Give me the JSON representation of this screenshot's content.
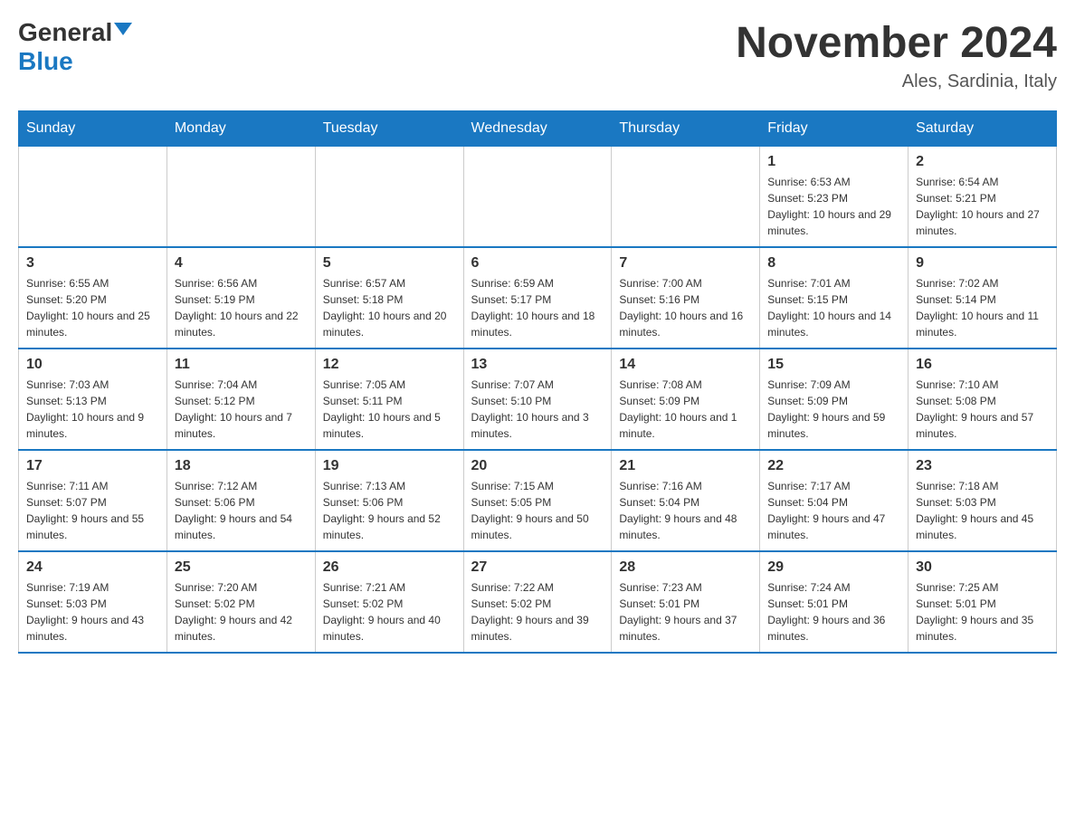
{
  "header": {
    "logo_general": "General",
    "logo_blue": "Blue",
    "month_title": "November 2024",
    "location": "Ales, Sardinia, Italy"
  },
  "days_of_week": [
    "Sunday",
    "Monday",
    "Tuesday",
    "Wednesday",
    "Thursday",
    "Friday",
    "Saturday"
  ],
  "weeks": [
    {
      "days": [
        {
          "number": "",
          "info": ""
        },
        {
          "number": "",
          "info": ""
        },
        {
          "number": "",
          "info": ""
        },
        {
          "number": "",
          "info": ""
        },
        {
          "number": "",
          "info": ""
        },
        {
          "number": "1",
          "info": "Sunrise: 6:53 AM\nSunset: 5:23 PM\nDaylight: 10 hours and 29 minutes."
        },
        {
          "number": "2",
          "info": "Sunrise: 6:54 AM\nSunset: 5:21 PM\nDaylight: 10 hours and 27 minutes."
        }
      ]
    },
    {
      "days": [
        {
          "number": "3",
          "info": "Sunrise: 6:55 AM\nSunset: 5:20 PM\nDaylight: 10 hours and 25 minutes."
        },
        {
          "number": "4",
          "info": "Sunrise: 6:56 AM\nSunset: 5:19 PM\nDaylight: 10 hours and 22 minutes."
        },
        {
          "number": "5",
          "info": "Sunrise: 6:57 AM\nSunset: 5:18 PM\nDaylight: 10 hours and 20 minutes."
        },
        {
          "number": "6",
          "info": "Sunrise: 6:59 AM\nSunset: 5:17 PM\nDaylight: 10 hours and 18 minutes."
        },
        {
          "number": "7",
          "info": "Sunrise: 7:00 AM\nSunset: 5:16 PM\nDaylight: 10 hours and 16 minutes."
        },
        {
          "number": "8",
          "info": "Sunrise: 7:01 AM\nSunset: 5:15 PM\nDaylight: 10 hours and 14 minutes."
        },
        {
          "number": "9",
          "info": "Sunrise: 7:02 AM\nSunset: 5:14 PM\nDaylight: 10 hours and 11 minutes."
        }
      ]
    },
    {
      "days": [
        {
          "number": "10",
          "info": "Sunrise: 7:03 AM\nSunset: 5:13 PM\nDaylight: 10 hours and 9 minutes."
        },
        {
          "number": "11",
          "info": "Sunrise: 7:04 AM\nSunset: 5:12 PM\nDaylight: 10 hours and 7 minutes."
        },
        {
          "number": "12",
          "info": "Sunrise: 7:05 AM\nSunset: 5:11 PM\nDaylight: 10 hours and 5 minutes."
        },
        {
          "number": "13",
          "info": "Sunrise: 7:07 AM\nSunset: 5:10 PM\nDaylight: 10 hours and 3 minutes."
        },
        {
          "number": "14",
          "info": "Sunrise: 7:08 AM\nSunset: 5:09 PM\nDaylight: 10 hours and 1 minute."
        },
        {
          "number": "15",
          "info": "Sunrise: 7:09 AM\nSunset: 5:09 PM\nDaylight: 9 hours and 59 minutes."
        },
        {
          "number": "16",
          "info": "Sunrise: 7:10 AM\nSunset: 5:08 PM\nDaylight: 9 hours and 57 minutes."
        }
      ]
    },
    {
      "days": [
        {
          "number": "17",
          "info": "Sunrise: 7:11 AM\nSunset: 5:07 PM\nDaylight: 9 hours and 55 minutes."
        },
        {
          "number": "18",
          "info": "Sunrise: 7:12 AM\nSunset: 5:06 PM\nDaylight: 9 hours and 54 minutes."
        },
        {
          "number": "19",
          "info": "Sunrise: 7:13 AM\nSunset: 5:06 PM\nDaylight: 9 hours and 52 minutes."
        },
        {
          "number": "20",
          "info": "Sunrise: 7:15 AM\nSunset: 5:05 PM\nDaylight: 9 hours and 50 minutes."
        },
        {
          "number": "21",
          "info": "Sunrise: 7:16 AM\nSunset: 5:04 PM\nDaylight: 9 hours and 48 minutes."
        },
        {
          "number": "22",
          "info": "Sunrise: 7:17 AM\nSunset: 5:04 PM\nDaylight: 9 hours and 47 minutes."
        },
        {
          "number": "23",
          "info": "Sunrise: 7:18 AM\nSunset: 5:03 PM\nDaylight: 9 hours and 45 minutes."
        }
      ]
    },
    {
      "days": [
        {
          "number": "24",
          "info": "Sunrise: 7:19 AM\nSunset: 5:03 PM\nDaylight: 9 hours and 43 minutes."
        },
        {
          "number": "25",
          "info": "Sunrise: 7:20 AM\nSunset: 5:02 PM\nDaylight: 9 hours and 42 minutes."
        },
        {
          "number": "26",
          "info": "Sunrise: 7:21 AM\nSunset: 5:02 PM\nDaylight: 9 hours and 40 minutes."
        },
        {
          "number": "27",
          "info": "Sunrise: 7:22 AM\nSunset: 5:02 PM\nDaylight: 9 hours and 39 minutes."
        },
        {
          "number": "28",
          "info": "Sunrise: 7:23 AM\nSunset: 5:01 PM\nDaylight: 9 hours and 37 minutes."
        },
        {
          "number": "29",
          "info": "Sunrise: 7:24 AM\nSunset: 5:01 PM\nDaylight: 9 hours and 36 minutes."
        },
        {
          "number": "30",
          "info": "Sunrise: 7:25 AM\nSunset: 5:01 PM\nDaylight: 9 hours and 35 minutes."
        }
      ]
    }
  ]
}
